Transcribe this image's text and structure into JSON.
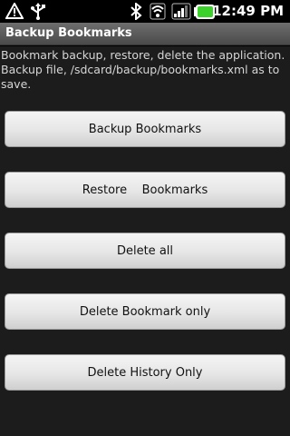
{
  "status_bar": {
    "time": "12:49 PM",
    "icons": [
      "warning-icon",
      "usb-icon",
      "bluetooth-icon",
      "wifi-icon",
      "signal-icon",
      "battery-icon"
    ]
  },
  "app": {
    "title": "Backup Bookmarks"
  },
  "main": {
    "description_lines": [
      "Bookmark backup, restore, delete the application.",
      "Backup file, /sdcard/backup/bookmarks.xml as to",
      "save."
    ]
  },
  "buttons": {
    "backup": "Backup Bookmarks",
    "restore": "Restore    Bookmarks",
    "delete_all": "Delete all",
    "delete_bookmark_only": "Delete Bookmark only",
    "delete_history_only": "Delete History Only"
  },
  "colors": {
    "battery": "#3dd12b",
    "background": "#1c1c1c",
    "titlebar": "#5a5a5a"
  }
}
